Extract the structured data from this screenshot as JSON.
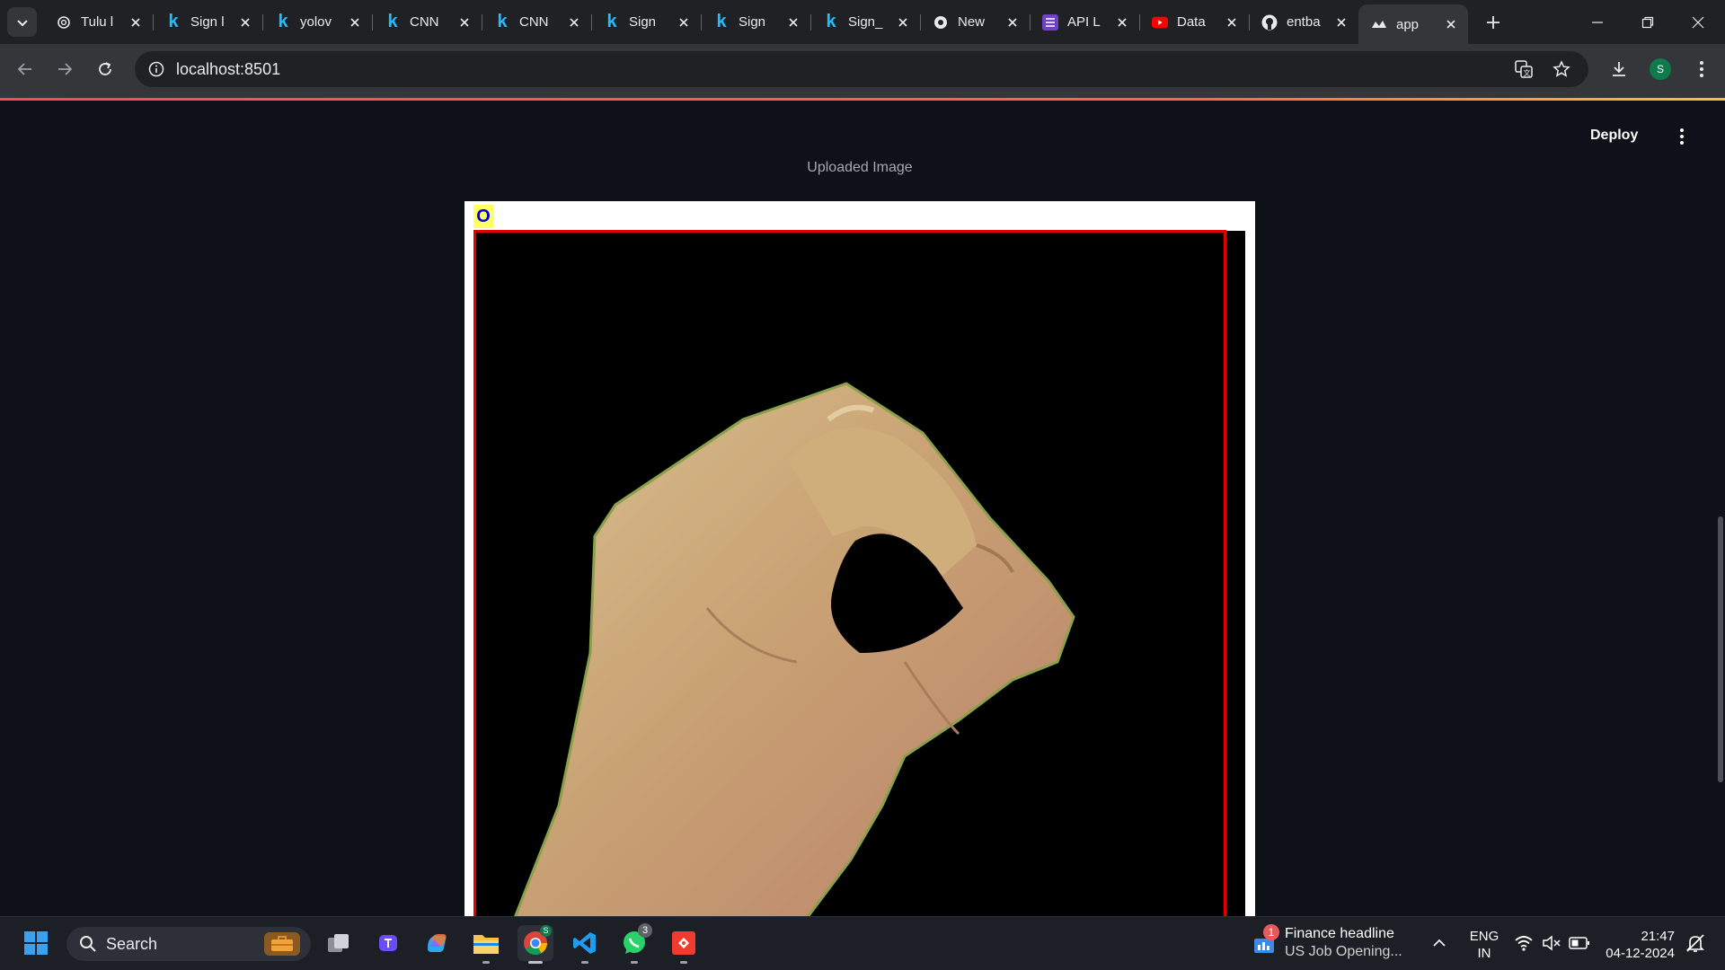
{
  "browser": {
    "tabs": [
      {
        "title": "Tulu l",
        "favicon": "openai-icon"
      },
      {
        "title": "Sign l",
        "favicon": "kaggle-icon"
      },
      {
        "title": "yolov",
        "favicon": "kaggle-icon"
      },
      {
        "title": "CNN",
        "favicon": "kaggle-icon"
      },
      {
        "title": "CNN",
        "favicon": "kaggle-icon"
      },
      {
        "title": "Sign",
        "favicon": "kaggle-icon"
      },
      {
        "title": "Sign",
        "favicon": "kaggle-icon"
      },
      {
        "title": "Sign_",
        "favicon": "kaggle-icon"
      },
      {
        "title": "New",
        "favicon": "chrome-icon"
      },
      {
        "title": "API L",
        "favicon": "list-icon"
      },
      {
        "title": "Data",
        "favicon": "youtube-icon"
      },
      {
        "title": "entba",
        "favicon": "github-icon"
      },
      {
        "title": "app",
        "favicon": "streamlit-icon",
        "active": true
      }
    ],
    "address": "localhost:8501",
    "profile_initial": "S",
    "accent": "#ff4b4b"
  },
  "app": {
    "deploy_label": "Deploy",
    "image_caption": "Uploaded Image",
    "detection": {
      "label": "O",
      "box_color": "#e00000",
      "label_bg": "#ffff66",
      "label_color": "#0000d0"
    }
  },
  "taskbar": {
    "search_label": "Search",
    "apps": [
      "start-icon",
      "search-icon",
      "task-view-icon",
      "teams-icon",
      "copilot-icon",
      "file-explorer-icon",
      "chrome-icon",
      "vscode-icon",
      "whatsapp-icon",
      "git-icon"
    ],
    "whatsapp_badge": "3",
    "news_badge": "1",
    "news_title": "Finance headline",
    "news_subtitle": "US Job Opening...",
    "language_line1": "ENG",
    "language_line2": "IN",
    "time": "21:47",
    "date": "04-12-2024"
  }
}
